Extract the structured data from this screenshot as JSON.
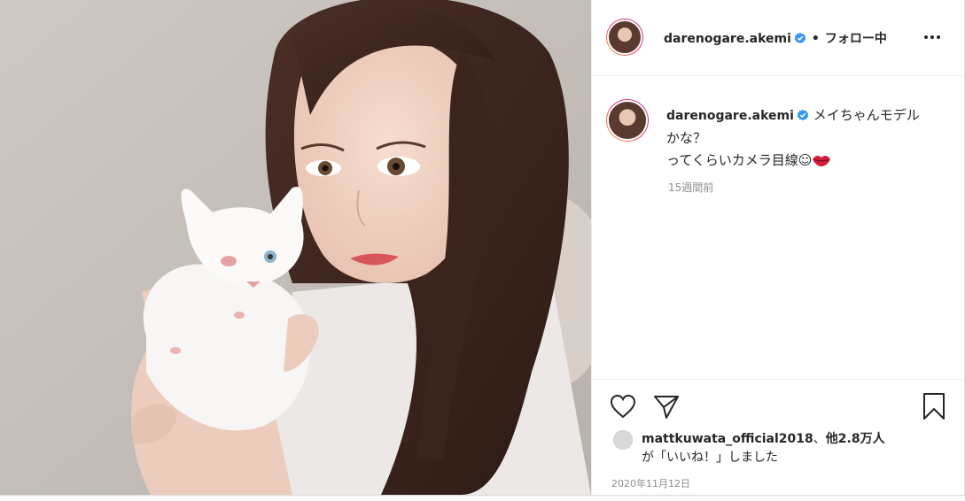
{
  "post": {
    "username": "darenogare.akemi",
    "verified_icon": "verified-badge-icon",
    "dot": "•",
    "follow_status": "フォロー中",
    "more_icon": "more-options-icon"
  },
  "caption": {
    "username": "darenogare.akemi",
    "line1": "メイちゃんモデルかな？",
    "line2": "ってくらいカメラ目線☺",
    "emoji_icon": "kiss-lips-icon",
    "time_ago": "15週間前"
  },
  "actions": {
    "like_icon": "heart-icon",
    "share_icon": "send-icon",
    "save_icon": "bookmark-icon"
  },
  "likes": {
    "liker": "mattkuwata_official2018",
    "separator": "、",
    "others": "他2.8万人",
    "suffix": "が「いいね！」しました"
  },
  "date": "2020年11月12日",
  "colors": {
    "verified": "#3897f0",
    "text": "#262626",
    "muted": "#8e8e8e",
    "lips": "#d81b3c"
  }
}
